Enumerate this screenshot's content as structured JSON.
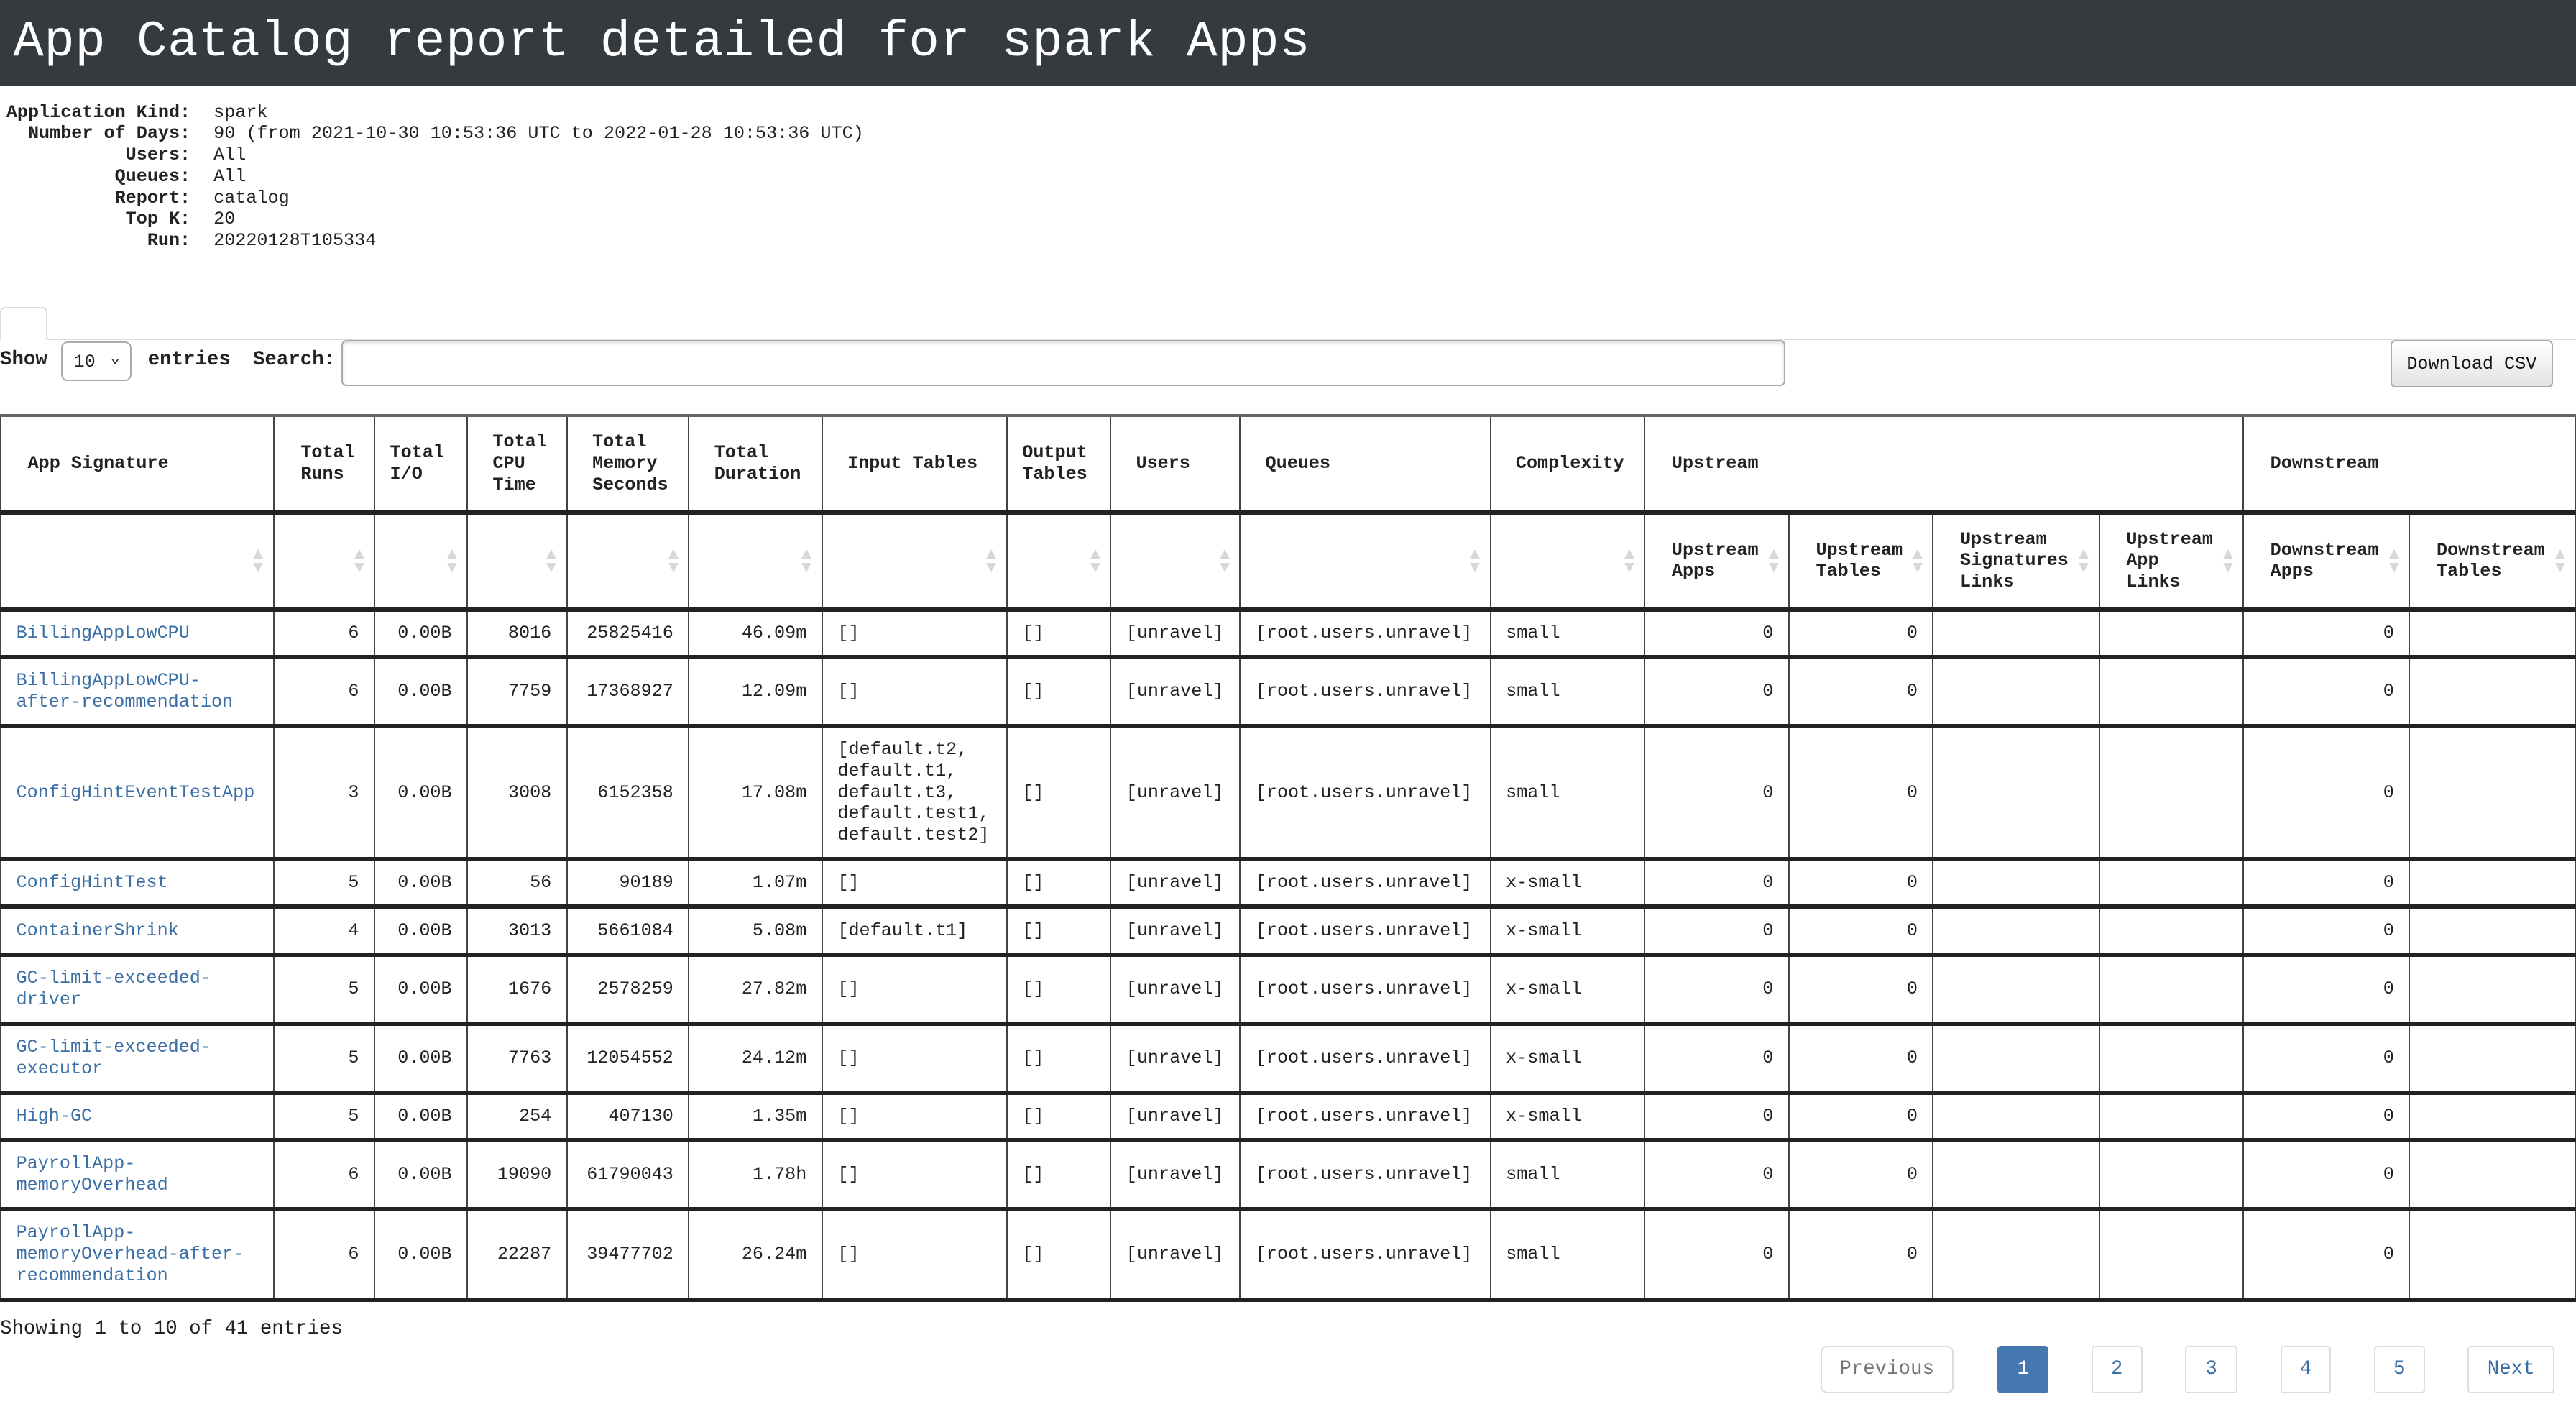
{
  "header": {
    "title": "App Catalog report detailed for spark Apps"
  },
  "meta": [
    {
      "label": "Application Kind:",
      "value": "spark"
    },
    {
      "label": "Number of Days:",
      "value": "90 (from 2021-10-30 10:53:36 UTC to 2022-01-28 10:53:36 UTC)"
    },
    {
      "label": "Users:",
      "value": "All"
    },
    {
      "label": "Queues:",
      "value": "All"
    },
    {
      "label": "Report:",
      "value": "catalog"
    },
    {
      "label": "Top K:",
      "value": "20"
    },
    {
      "label": "Run:",
      "value": "20220128T105334"
    }
  ],
  "controls": {
    "show_label": "Show",
    "page_size": "10",
    "entries_label": "entries",
    "search_label": "Search:",
    "search_value": "",
    "download_label": "Download CSV"
  },
  "table": {
    "group_headers": {
      "app_signature": "App Signature",
      "total_runs": "Total Runs",
      "total_io": "Total I/O",
      "total_cpu": "Total CPU Time",
      "total_mem": "Total Memory Seconds",
      "total_duration": "Total Duration",
      "input_tables": "Input Tables",
      "output_tables": "Output Tables",
      "users": "Users",
      "queues": "Queues",
      "complexity": "Complexity",
      "upstream": "Upstream",
      "downstream": "Downstream"
    },
    "sub_headers": {
      "upstream_apps": "Upstream Apps",
      "upstream_tables": "Upstream Tables",
      "upstream_sig_links": "Upstream Signatures Links",
      "upstream_app_links": "Upstream App Links",
      "downstream_apps": "Downstream Apps",
      "downstream_tables": "Downstream Tables"
    },
    "rows": [
      {
        "sig": "BillingAppLowCPU",
        "runs": "6",
        "io": "0.00B",
        "cpu": "8016",
        "mem": "25825416",
        "dur": "46.09m",
        "in": "[]",
        "out": "[]",
        "users": "[unravel]",
        "queues": "[root.users.unravel]",
        "cx": "small",
        "ua": "0",
        "ut": "0",
        "usl": "",
        "ual": "",
        "da": "0"
      },
      {
        "sig": "BillingAppLowCPU-after-recommendation",
        "runs": "6",
        "io": "0.00B",
        "cpu": "7759",
        "mem": "17368927",
        "dur": "12.09m",
        "in": "[]",
        "out": "[]",
        "users": "[unravel]",
        "queues": "[root.users.unravel]",
        "cx": "small",
        "ua": "0",
        "ut": "0",
        "usl": "",
        "ual": "",
        "da": "0"
      },
      {
        "sig": "ConfigHintEventTestApp",
        "runs": "3",
        "io": "0.00B",
        "cpu": "3008",
        "mem": "6152358",
        "dur": "17.08m",
        "in": "[default.t2, default.t1, default.t3, default.test1, default.test2]",
        "out": "[]",
        "users": "[unravel]",
        "queues": "[root.users.unravel]",
        "cx": "small",
        "ua": "0",
        "ut": "0",
        "usl": "",
        "ual": "",
        "da": "0"
      },
      {
        "sig": "ConfigHintTest",
        "runs": "5",
        "io": "0.00B",
        "cpu": "56",
        "mem": "90189",
        "dur": "1.07m",
        "in": "[]",
        "out": "[]",
        "users": "[unravel]",
        "queues": "[root.users.unravel]",
        "cx": "x-small",
        "ua": "0",
        "ut": "0",
        "usl": "",
        "ual": "",
        "da": "0"
      },
      {
        "sig": "ContainerShrink",
        "runs": "4",
        "io": "0.00B",
        "cpu": "3013",
        "mem": "5661084",
        "dur": "5.08m",
        "in": "[default.t1]",
        "out": "[]",
        "users": "[unravel]",
        "queues": "[root.users.unravel]",
        "cx": "x-small",
        "ua": "0",
        "ut": "0",
        "usl": "",
        "ual": "",
        "da": "0"
      },
      {
        "sig": "GC-limit-exceeded-driver",
        "runs": "5",
        "io": "0.00B",
        "cpu": "1676",
        "mem": "2578259",
        "dur": "27.82m",
        "in": "[]",
        "out": "[]",
        "users": "[unravel]",
        "queues": "[root.users.unravel]",
        "cx": "x-small",
        "ua": "0",
        "ut": "0",
        "usl": "",
        "ual": "",
        "da": "0"
      },
      {
        "sig": "GC-limit-exceeded-executor",
        "runs": "5",
        "io": "0.00B",
        "cpu": "7763",
        "mem": "12054552",
        "dur": "24.12m",
        "in": "[]",
        "out": "[]",
        "users": "[unravel]",
        "queues": "[root.users.unravel]",
        "cx": "x-small",
        "ua": "0",
        "ut": "0",
        "usl": "",
        "ual": "",
        "da": "0"
      },
      {
        "sig": "High-GC",
        "runs": "5",
        "io": "0.00B",
        "cpu": "254",
        "mem": "407130",
        "dur": "1.35m",
        "in": "[]",
        "out": "[]",
        "users": "[unravel]",
        "queues": "[root.users.unravel]",
        "cx": "x-small",
        "ua": "0",
        "ut": "0",
        "usl": "",
        "ual": "",
        "da": "0"
      },
      {
        "sig": "PayrollApp-memoryOverhead",
        "runs": "6",
        "io": "0.00B",
        "cpu": "19090",
        "mem": "61790043",
        "dur": "1.78h",
        "in": "[]",
        "out": "[]",
        "users": "[unravel]",
        "queues": "[root.users.unravel]",
        "cx": "small",
        "ua": "0",
        "ut": "0",
        "usl": "",
        "ual": "",
        "da": "0"
      },
      {
        "sig": "PayrollApp-memoryOverhead-after-recommendation",
        "runs": "6",
        "io": "0.00B",
        "cpu": "22287",
        "mem": "39477702",
        "dur": "26.24m",
        "in": "[]",
        "out": "[]",
        "users": "[unravel]",
        "queues": "[root.users.unravel]",
        "cx": "small",
        "ua": "0",
        "ut": "0",
        "usl": "",
        "ual": "",
        "da": "0"
      }
    ]
  },
  "footer": {
    "info": "Showing 1 to 10 of 41 entries",
    "previous": "Previous",
    "next": "Next",
    "pages": [
      "1",
      "2",
      "3",
      "4",
      "5"
    ],
    "current_page": "1"
  },
  "colors": {
    "header_bg": "#353a3e",
    "link": "#3a6ea5",
    "active_page": "#4577b0"
  }
}
